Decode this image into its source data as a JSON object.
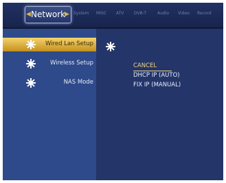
{
  "header": {
    "active_tab": "Network",
    "tabs": [
      "System",
      "MISC",
      "ATV",
      "DVB-T",
      "Audio",
      "Video",
      "Record"
    ]
  },
  "menu": {
    "items": [
      {
        "label": "Wired Lan Setup",
        "selected": true
      },
      {
        "label": "Wireless Setup",
        "selected": false
      },
      {
        "label": "NAS Mode",
        "selected": false
      }
    ]
  },
  "options": {
    "cancel": "CANCEL",
    "dhcp": "DHCP IP (AUTO)",
    "fix": "FIX IP (MANUAL)"
  },
  "colors": {
    "background": "#2d3f74",
    "selected": "#e0b448",
    "highlight_text": "#f0d77e"
  }
}
